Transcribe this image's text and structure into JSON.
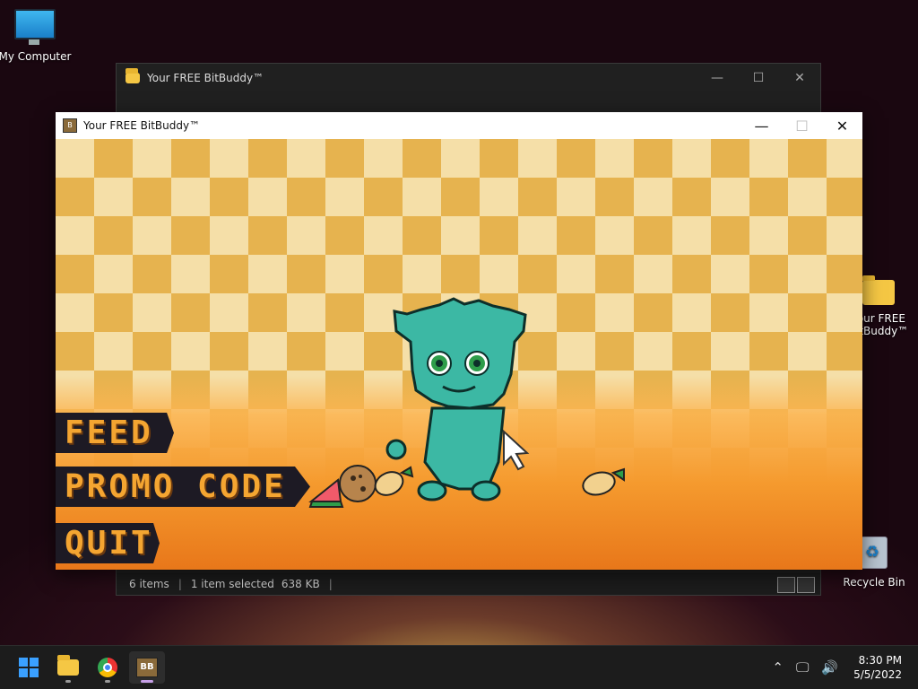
{
  "desktop": {
    "icons": [
      {
        "label": "My Computer"
      },
      {
        "label": "Your FREE BitBuddy™"
      },
      {
        "label": "Recycle Bin"
      }
    ]
  },
  "explorer": {
    "title": "Your FREE BitBuddy™",
    "status": {
      "items": "6 items",
      "selected": "1 item selected",
      "size": "638 KB"
    }
  },
  "game": {
    "title": "Your FREE BitBuddy™",
    "menu": {
      "feed": "FEED",
      "promo": "PROMO CODE",
      "quit": "QUIT"
    }
  },
  "taskbar": {
    "time": "8:30 PM",
    "date": "5/5/2022"
  },
  "colors": {
    "creature": "#3cb8a4",
    "menu_text": "#f4a531",
    "menu_bg": "#1d1a24"
  }
}
